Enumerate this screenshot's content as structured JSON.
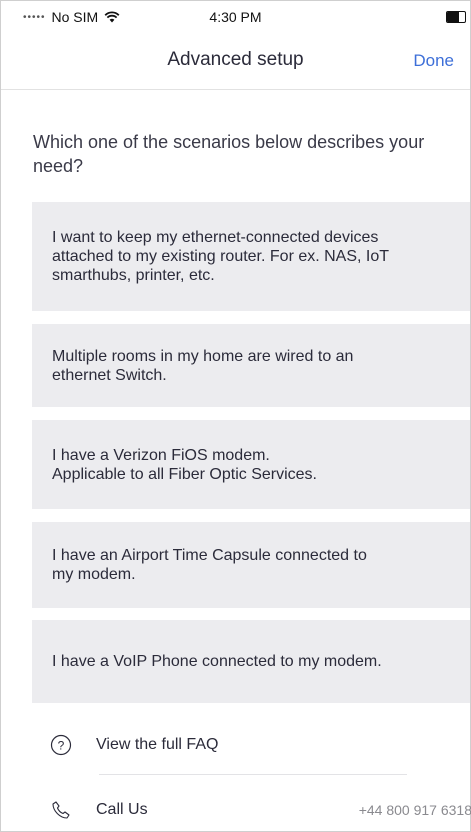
{
  "status_bar": {
    "carrier": "No SIM",
    "time": "4:30 PM",
    "battery_level": 0.65
  },
  "nav": {
    "title": "Advanced setup",
    "done_label": "Done"
  },
  "question": "Which one of the scenarios below describes your need?",
  "options": [
    {
      "label": "I want to keep my ethernet-connected devices\nattached to my existing router. For ex. NAS, IoT\nsmarthubs, printer, etc."
    },
    {
      "label": "Multiple rooms in my home are wired to an\nethernet Switch."
    },
    {
      "label": "I have a Verizon FiOS modem.\nApplicable to all Fiber Optic Services."
    },
    {
      "label": "I have an Airport Time Capsule connected to\nmy modem."
    },
    {
      "label": "I have a VoIP Phone connected to my modem."
    }
  ],
  "footer": {
    "faq_label": "View the full FAQ",
    "faq_icon": "question-circle-icon",
    "call_label": "Call Us",
    "call_icon": "phone-icon",
    "phone_number": "+44 800 917 6318"
  },
  "colors": {
    "accent": "#3d6fd8",
    "option_bg": "#ececef",
    "text": "#2b2b3a"
  }
}
